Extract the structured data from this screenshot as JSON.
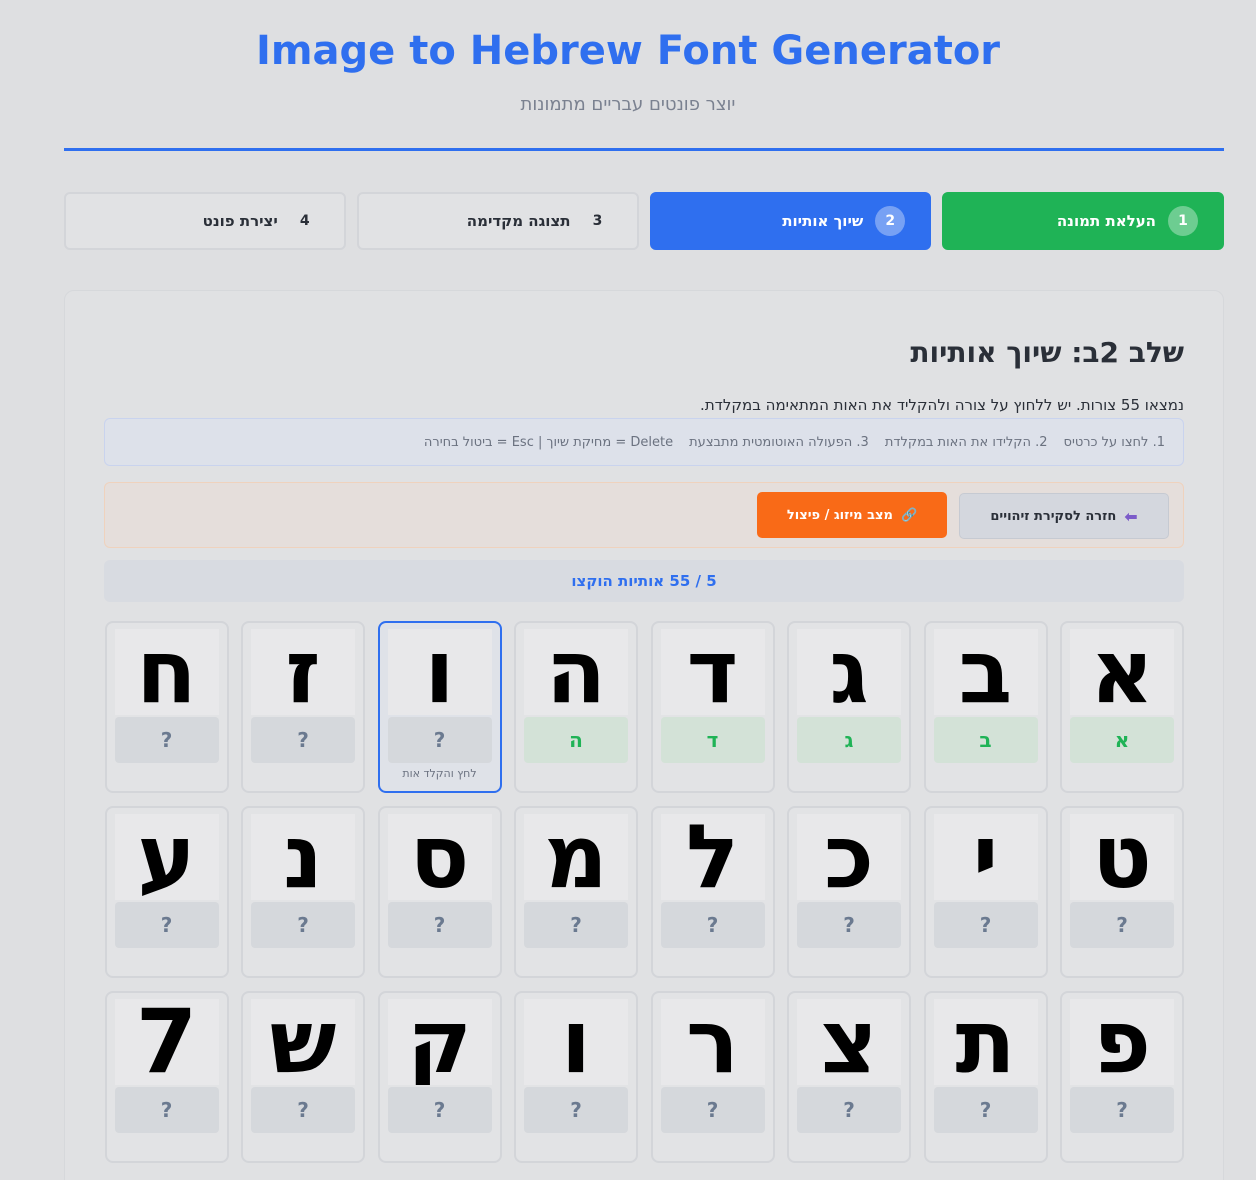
{
  "header": {
    "title": "Image to Hebrew Font Generator",
    "subtitle": "יוצר פונטים עבריים מתמונות"
  },
  "steps": [
    {
      "num": "1",
      "label": "העלאת תמונה",
      "state": "done"
    },
    {
      "num": "2",
      "label": "שיוך אותיות",
      "state": "active"
    },
    {
      "num": "3",
      "label": "תצוגה מקדימה",
      "state": "todo"
    },
    {
      "num": "4",
      "label": "יצירת פונט",
      "state": "todo"
    }
  ],
  "main": {
    "heading": "שלב 2ב: שיוך אותיות",
    "description": "נמצאו 55 צורות. יש ללחוץ על צורה ולהקליד את האות המתאימה במקלדת.",
    "hints": [
      "1. לחצו על כרטיס",
      "2. הקלידו את האות במקלדת",
      "3. הפעולה האוטומטית מתבצעת",
      "Delete = מחיקת שיוך | Esc = ביטול בחירה"
    ],
    "back_button": "חזרה לסקירת זיהויים",
    "back_icon": "back-arrow-icon",
    "merge_button": "מצב מיזוג / פיצול",
    "merge_icon": "link-icon",
    "progress": "5 / 55 אותיות הוקצו",
    "selected_hint": "לחץ והקלד אות"
  },
  "tiles": [
    {
      "glyph": "א",
      "assigned": "א"
    },
    {
      "glyph": "ב",
      "assigned": "ב"
    },
    {
      "glyph": "ג",
      "assigned": "ג"
    },
    {
      "glyph": "ד",
      "assigned": "ד"
    },
    {
      "glyph": "ה",
      "assigned": "ה"
    },
    {
      "glyph": "ו",
      "assigned": "?",
      "selected": true
    },
    {
      "glyph": "ז",
      "assigned": "?"
    },
    {
      "glyph": "ח",
      "assigned": "?"
    },
    {
      "glyph": "ט",
      "assigned": "?"
    },
    {
      "glyph": "י",
      "assigned": "?"
    },
    {
      "glyph": "כ",
      "assigned": "?"
    },
    {
      "glyph": "ל",
      "assigned": "?"
    },
    {
      "glyph": "מ",
      "assigned": "?"
    },
    {
      "glyph": "ס",
      "assigned": "?"
    },
    {
      "glyph": "נ",
      "assigned": "?"
    },
    {
      "glyph": "ע",
      "assigned": "?"
    },
    {
      "glyph": "פ",
      "assigned": "?"
    },
    {
      "glyph": "ת",
      "assigned": "?"
    },
    {
      "glyph": "צ",
      "assigned": "?"
    },
    {
      "glyph": "ר",
      "assigned": "?"
    },
    {
      "glyph": "ו",
      "assigned": "?"
    },
    {
      "glyph": "ק",
      "assigned": "?"
    },
    {
      "glyph": "ש",
      "assigned": "?"
    },
    {
      "glyph": "7",
      "assigned": "?"
    }
  ],
  "colors": {
    "accent": "#2f6fef",
    "success": "#1fb356",
    "merge": "#f96a17"
  }
}
